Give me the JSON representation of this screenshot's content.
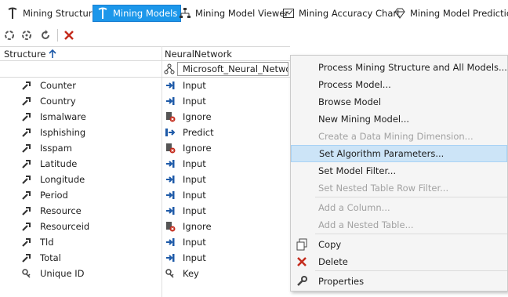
{
  "tabs": [
    {
      "label": "Mining Structure",
      "icon": "pickaxe-icon"
    },
    {
      "label": "Mining Models",
      "icon": "pickaxe-icon",
      "active": true
    },
    {
      "label": "Mining Model Viewer",
      "icon": "tree-viewer-icon"
    },
    {
      "label": "Mining Accuracy Chart",
      "icon": "chart-icon"
    },
    {
      "label": "Mining Model Prediction",
      "icon": "diamond-icon"
    }
  ],
  "grid": {
    "structure_header": "Structure",
    "model_header": "NeuralNetwork",
    "algorithm": "Microsoft_Neural_Network",
    "rows": [
      {
        "name": "Counter",
        "usage": "Input"
      },
      {
        "name": "Country",
        "usage": "Input"
      },
      {
        "name": "Ismalware",
        "usage": "Ignore"
      },
      {
        "name": "Isphishing",
        "usage": "Predict"
      },
      {
        "name": "Isspam",
        "usage": "Ignore"
      },
      {
        "name": "Latitude",
        "usage": "Input"
      },
      {
        "name": "Longitude",
        "usage": "Input"
      },
      {
        "name": "Period",
        "usage": "Input"
      },
      {
        "name": "Resource",
        "usage": "Input"
      },
      {
        "name": "Resourceid",
        "usage": "Ignore"
      },
      {
        "name": "Tld",
        "usage": "Input"
      },
      {
        "name": "Total",
        "usage": "Input"
      },
      {
        "name": "Unique ID",
        "usage": "Key"
      }
    ]
  },
  "context_menu": {
    "items": [
      {
        "label": "Process Mining Structure and All Models...",
        "enabled": true
      },
      {
        "label": "Process Model...",
        "enabled": true
      },
      {
        "label": "Browse Model",
        "enabled": true
      },
      {
        "label": "New Mining Model...",
        "enabled": true
      },
      {
        "label": "Create a Data Mining Dimension...",
        "enabled": false
      },
      {
        "label": "Set Algorithm Parameters...",
        "enabled": true,
        "highlighted": true
      },
      {
        "label": "Set Model Filter...",
        "enabled": true
      },
      {
        "label": "Set Nested Table Row Filter...",
        "enabled": false
      },
      {
        "label": "Add a Column...",
        "enabled": false
      },
      {
        "label": "Add a Nested Table...",
        "enabled": false
      },
      {
        "label": "Copy",
        "enabled": true,
        "icon": "copy-icon"
      },
      {
        "label": "Delete",
        "enabled": true,
        "icon": "delete-icon"
      },
      {
        "label": "Properties",
        "enabled": true,
        "icon": "wrench-icon"
      }
    ]
  },
  "colors": {
    "accent": "#1c97ea",
    "highlight": "#cce4f7",
    "delete": "#c42b1c",
    "input_arrow": "#1e5aa8"
  }
}
